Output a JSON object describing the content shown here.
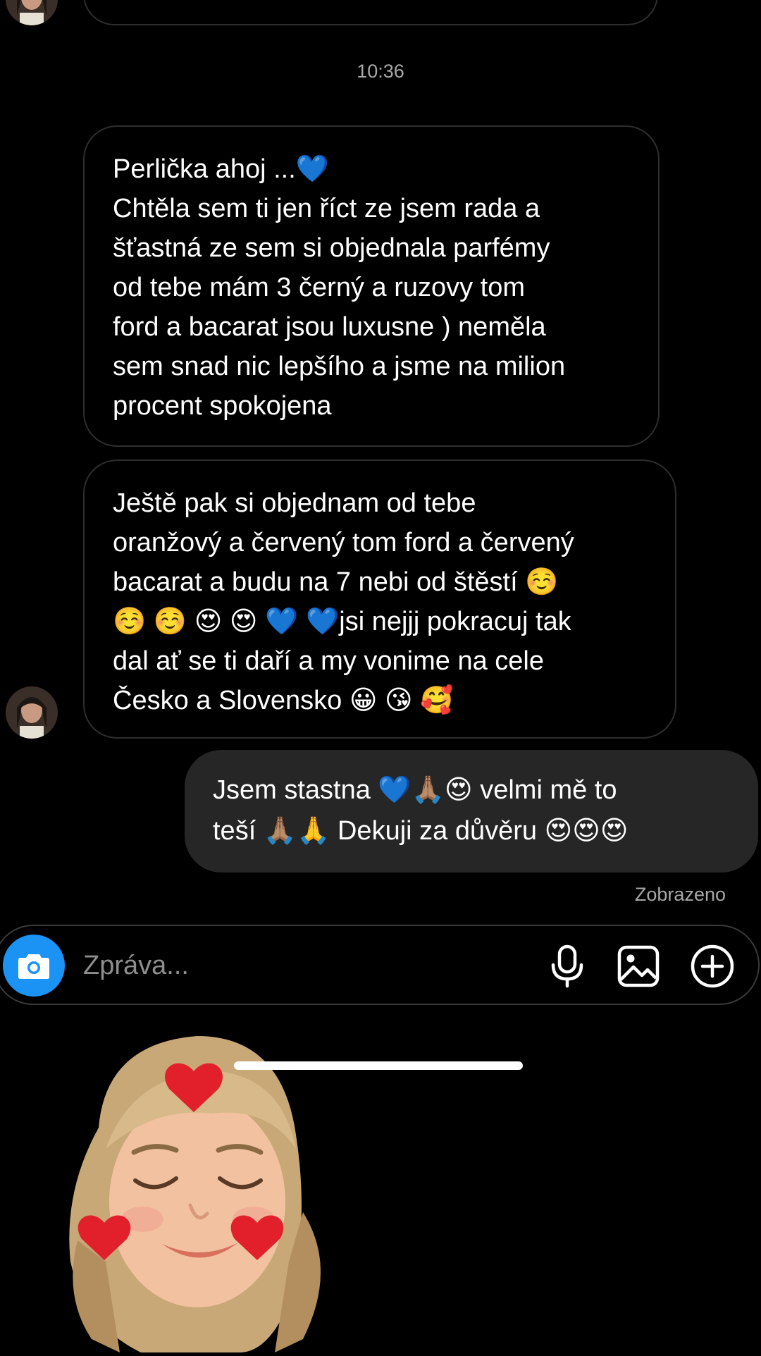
{
  "thread": {
    "timestamp": "10:36",
    "incoming": [
      {
        "lines": [
          "Perlička ahoj ...💙",
          "Chtěla sem ti jen říct ze jsem rada a",
          "šťastná ze sem si objednala parfémy",
          "od tebe mám 3 černý a ruzovy tom",
          "ford a bacarat jsou luxusne ) neměla",
          "sem snad nic lepšího a jsme na milion",
          "procent spokojena"
        ]
      },
      {
        "lines": [
          "Ještě pak si objednam od tebe",
          "oranžový a červený tom ford a červený",
          "bacarat a budu na 7 nebi od štěstí ☺️",
          "☺️ ☺️ 😍 😍 💙 💙jsi nejjj pokracuj tak",
          "dal ať se ti daří a my vonime na cele",
          "Česko a Slovensko 😀 😘 🥰"
        ]
      }
    ],
    "outgoing": [
      {
        "lines": [
          "Jsem stastna 💙🙏🏽😍 velmi mě to",
          "teší 🙏🏽🙏 Dekuji za důvěru 😍😍😍"
        ]
      }
    ],
    "seen_status": "Zobrazeno"
  },
  "composer": {
    "placeholder": "Zpráva...",
    "camera_icon": "camera-icon",
    "mic_icon": "microphone-icon",
    "gallery_icon": "gallery-icon",
    "add_icon": "plus-circle-icon"
  },
  "colors": {
    "background": "#000000",
    "incoming_border": "#2e2e2e",
    "outgoing_bubble": "#262626",
    "accent_blue": "#1a93f5",
    "muted_text": "#a8a8a8"
  },
  "sticker": {
    "icon": "memoji-sticker-icon"
  }
}
